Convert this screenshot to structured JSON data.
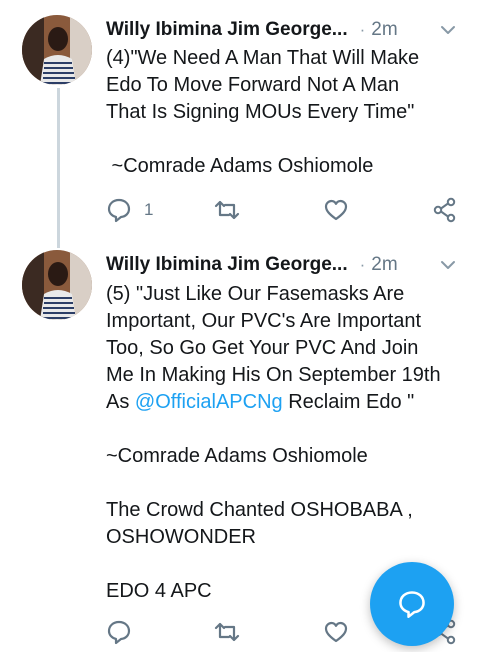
{
  "tweets": [
    {
      "author": "Willy Ibimina Jim George...",
      "separator": "·",
      "time": "2m",
      "lines": [
        "(4)\"We Need A Man That Will Make",
        "Edo To Move Forward Not A Man",
        "That Is Signing MOUs Every Time\"",
        "",
        " ~Comrade Adams Oshiomole"
      ],
      "reply_count": "1"
    },
    {
      "author": "Willy Ibimina Jim George...",
      "separator": "·",
      "time": "2m",
      "lines_before_mention": [
        "(5) \"Just Like Our Fasemasks Are",
        "Important, Our PVC's Are Important",
        "Too, So Go Get Your PVC And Join",
        "Me In Making His On September 19th"
      ],
      "mention_prefix": "As ",
      "mention": "@OfficialAPCNg",
      "mention_suffix": " Reclaim Edo \"",
      "signature": "~Comrade Adams Oshiomole",
      "crowd_lines": [
        "The Crowd Chanted OSHOBABA ,",
        "OSHOWONDER"
      ],
      "closing": "EDO 4 APC",
      "reply_count": ""
    }
  ],
  "colors": {
    "accent": "#1da1f2",
    "icon": "#657786",
    "thread_line": "#ccd6dd"
  },
  "icons": [
    "chevron-down-icon",
    "reply-icon",
    "retweet-icon",
    "like-icon",
    "share-icon",
    "compose-reply-icon"
  ]
}
